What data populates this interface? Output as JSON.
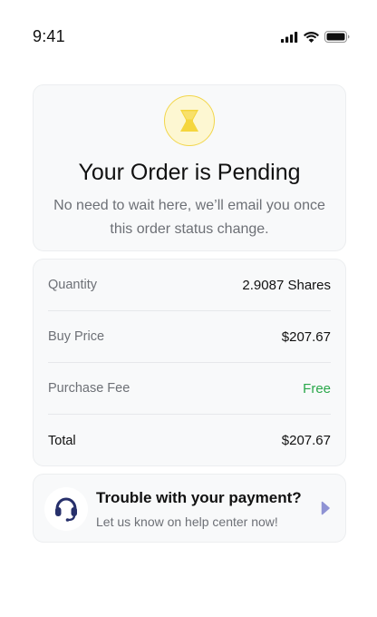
{
  "status_bar": {
    "time": "9:41"
  },
  "pending": {
    "icon": "hourglass-icon",
    "title": "Your Order is Pending",
    "subtitle_line1": "No need to wait here, we’ll email you once",
    "subtitle_line2": "this order status change."
  },
  "details": {
    "rows": [
      {
        "label": "Quantity",
        "value": "2.9087 Shares"
      },
      {
        "label": "Buy Price",
        "value": "$207.67"
      },
      {
        "label": "Purchase Fee",
        "value": "Free"
      },
      {
        "label": "Total",
        "value": "$207.67"
      }
    ]
  },
  "help": {
    "icon": "headset-icon",
    "title": "Trouble with your payment?",
    "subtitle": "Let us know on help center now!"
  },
  "colors": {
    "accent_yellow": "#f5d63d",
    "free_green": "#2aa84a",
    "headset_navy": "#27306b",
    "arrow_purple": "#8f93d4"
  }
}
